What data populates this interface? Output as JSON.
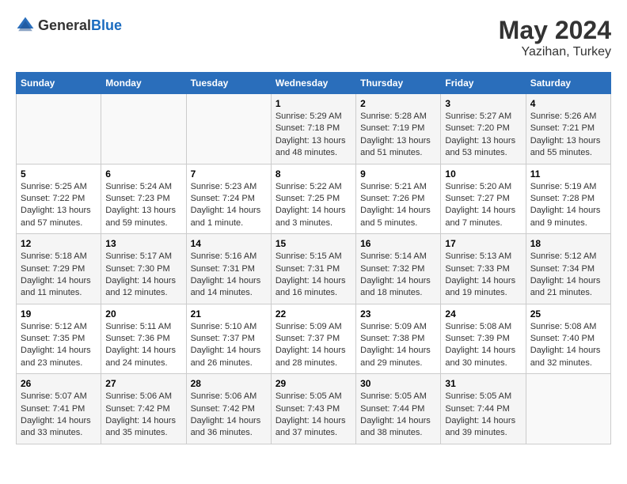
{
  "header": {
    "logo_general": "General",
    "logo_blue": "Blue",
    "month": "May 2024",
    "location": "Yazihan, Turkey"
  },
  "weekdays": [
    "Sunday",
    "Monday",
    "Tuesday",
    "Wednesday",
    "Thursday",
    "Friday",
    "Saturday"
  ],
  "weeks": [
    [
      {
        "day": "",
        "info": ""
      },
      {
        "day": "",
        "info": ""
      },
      {
        "day": "",
        "info": ""
      },
      {
        "day": "1",
        "info": "Sunrise: 5:29 AM\nSunset: 7:18 PM\nDaylight: 13 hours\nand 48 minutes."
      },
      {
        "day": "2",
        "info": "Sunrise: 5:28 AM\nSunset: 7:19 PM\nDaylight: 13 hours\nand 51 minutes."
      },
      {
        "day": "3",
        "info": "Sunrise: 5:27 AM\nSunset: 7:20 PM\nDaylight: 13 hours\nand 53 minutes."
      },
      {
        "day": "4",
        "info": "Sunrise: 5:26 AM\nSunset: 7:21 PM\nDaylight: 13 hours\nand 55 minutes."
      }
    ],
    [
      {
        "day": "5",
        "info": "Sunrise: 5:25 AM\nSunset: 7:22 PM\nDaylight: 13 hours\nand 57 minutes."
      },
      {
        "day": "6",
        "info": "Sunrise: 5:24 AM\nSunset: 7:23 PM\nDaylight: 13 hours\nand 59 minutes."
      },
      {
        "day": "7",
        "info": "Sunrise: 5:23 AM\nSunset: 7:24 PM\nDaylight: 14 hours\nand 1 minute."
      },
      {
        "day": "8",
        "info": "Sunrise: 5:22 AM\nSunset: 7:25 PM\nDaylight: 14 hours\nand 3 minutes."
      },
      {
        "day": "9",
        "info": "Sunrise: 5:21 AM\nSunset: 7:26 PM\nDaylight: 14 hours\nand 5 minutes."
      },
      {
        "day": "10",
        "info": "Sunrise: 5:20 AM\nSunset: 7:27 PM\nDaylight: 14 hours\nand 7 minutes."
      },
      {
        "day": "11",
        "info": "Sunrise: 5:19 AM\nSunset: 7:28 PM\nDaylight: 14 hours\nand 9 minutes."
      }
    ],
    [
      {
        "day": "12",
        "info": "Sunrise: 5:18 AM\nSunset: 7:29 PM\nDaylight: 14 hours\nand 11 minutes."
      },
      {
        "day": "13",
        "info": "Sunrise: 5:17 AM\nSunset: 7:30 PM\nDaylight: 14 hours\nand 12 minutes."
      },
      {
        "day": "14",
        "info": "Sunrise: 5:16 AM\nSunset: 7:31 PM\nDaylight: 14 hours\nand 14 minutes."
      },
      {
        "day": "15",
        "info": "Sunrise: 5:15 AM\nSunset: 7:31 PM\nDaylight: 14 hours\nand 16 minutes."
      },
      {
        "day": "16",
        "info": "Sunrise: 5:14 AM\nSunset: 7:32 PM\nDaylight: 14 hours\nand 18 minutes."
      },
      {
        "day": "17",
        "info": "Sunrise: 5:13 AM\nSunset: 7:33 PM\nDaylight: 14 hours\nand 19 minutes."
      },
      {
        "day": "18",
        "info": "Sunrise: 5:12 AM\nSunset: 7:34 PM\nDaylight: 14 hours\nand 21 minutes."
      }
    ],
    [
      {
        "day": "19",
        "info": "Sunrise: 5:12 AM\nSunset: 7:35 PM\nDaylight: 14 hours\nand 23 minutes."
      },
      {
        "day": "20",
        "info": "Sunrise: 5:11 AM\nSunset: 7:36 PM\nDaylight: 14 hours\nand 24 minutes."
      },
      {
        "day": "21",
        "info": "Sunrise: 5:10 AM\nSunset: 7:37 PM\nDaylight: 14 hours\nand 26 minutes."
      },
      {
        "day": "22",
        "info": "Sunrise: 5:09 AM\nSunset: 7:37 PM\nDaylight: 14 hours\nand 28 minutes."
      },
      {
        "day": "23",
        "info": "Sunrise: 5:09 AM\nSunset: 7:38 PM\nDaylight: 14 hours\nand 29 minutes."
      },
      {
        "day": "24",
        "info": "Sunrise: 5:08 AM\nSunset: 7:39 PM\nDaylight: 14 hours\nand 30 minutes."
      },
      {
        "day": "25",
        "info": "Sunrise: 5:08 AM\nSunset: 7:40 PM\nDaylight: 14 hours\nand 32 minutes."
      }
    ],
    [
      {
        "day": "26",
        "info": "Sunrise: 5:07 AM\nSunset: 7:41 PM\nDaylight: 14 hours\nand 33 minutes."
      },
      {
        "day": "27",
        "info": "Sunrise: 5:06 AM\nSunset: 7:42 PM\nDaylight: 14 hours\nand 35 minutes."
      },
      {
        "day": "28",
        "info": "Sunrise: 5:06 AM\nSunset: 7:42 PM\nDaylight: 14 hours\nand 36 minutes."
      },
      {
        "day": "29",
        "info": "Sunrise: 5:05 AM\nSunset: 7:43 PM\nDaylight: 14 hours\nand 37 minutes."
      },
      {
        "day": "30",
        "info": "Sunrise: 5:05 AM\nSunset: 7:44 PM\nDaylight: 14 hours\nand 38 minutes."
      },
      {
        "day": "31",
        "info": "Sunrise: 5:05 AM\nSunset: 7:44 PM\nDaylight: 14 hours\nand 39 minutes."
      },
      {
        "day": "",
        "info": ""
      }
    ]
  ]
}
